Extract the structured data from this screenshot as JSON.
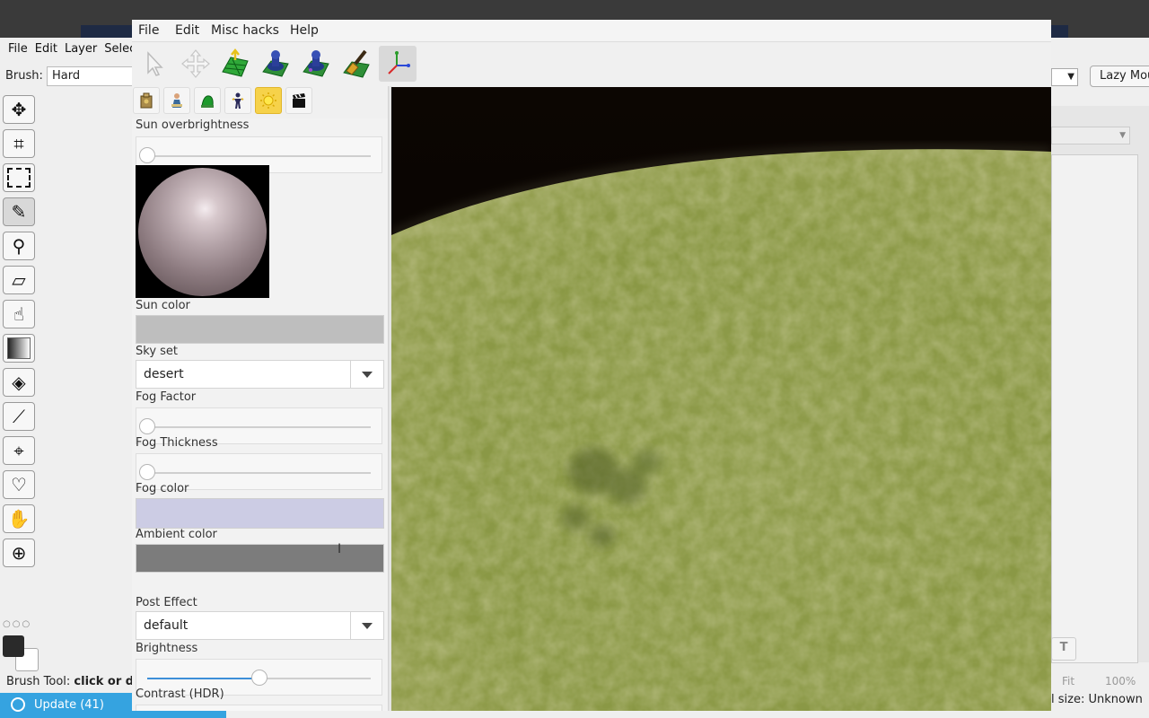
{
  "background_app": {
    "menu": [
      "File",
      "Edit",
      "Layer",
      "Selec"
    ],
    "brush_label": "Brush:",
    "brush_value": "Hard",
    "lazy_mouse_label": "Lazy Mou",
    "status_prefix": "Brush Tool: ",
    "status_bold": "click or dr",
    "update_label": "Update (41)",
    "fit_label": "Fit",
    "zoom_label": "100%",
    "size_label": "l size: Unknown",
    "text_tool_glyph": "T",
    "tools": [
      "move-icon",
      "crop-icon",
      "rect-select-icon",
      "brush-icon",
      "stamp-icon",
      "eraser-icon",
      "smudge-icon",
      "gradient-icon",
      "fill-icon",
      "eyedropper-icon",
      "path-icon",
      "shape-icon",
      "hand-icon",
      "zoom-icon"
    ]
  },
  "window": {
    "menu": {
      "file": "File",
      "edit": "Edit",
      "misc": "Misc hacks",
      "help": "Help"
    },
    "toolbar_icons": [
      "select-arrow-icon",
      "move-cross-icon",
      "terrain-up-icon",
      "sculpt-icon",
      "paint-icon",
      "brush-texture-icon",
      "axis-gizmo-icon"
    ],
    "tab_icons": [
      "building-icon",
      "character-icon",
      "tree-icon",
      "figure-icon",
      "sun-icon",
      "clapper-icon"
    ],
    "panel": {
      "sun_overbrightness_label": "Sun overbrightness",
      "sun_overbrightness_value": 0.0,
      "sun_color_label": "Sun color",
      "sun_color": "#bebebe",
      "sky_set_label": "Sky set",
      "sky_set_value": "desert",
      "fog_factor_label": "Fog Factor",
      "fog_factor_value": 0.0,
      "fog_thickness_label": "Fog Thickness",
      "fog_thickness_value": 0.0,
      "fog_color_label": "Fog color",
      "fog_color": "#cccce4",
      "ambient_color_label": "Ambient color",
      "ambient_color": "#7c7c7c",
      "post_effect_label": "Post Effect",
      "post_effect_value": "default",
      "brightness_label": "Brightness",
      "brightness_value": 0.5,
      "contrast_label": "Contrast (HDR)"
    },
    "colors": {
      "accent": "#3d8fd8",
      "active_tab": "#f6d24a",
      "grass": "#8b9a46",
      "sky": "#000000"
    }
  }
}
